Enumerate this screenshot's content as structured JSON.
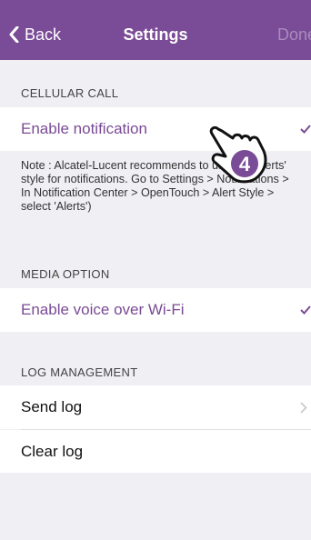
{
  "navbar": {
    "back_label": "Back",
    "title": "Settings",
    "done_label": "Done"
  },
  "sections": {
    "cellular": {
      "header": "CELLULAR CALL",
      "enable_notification": "Enable notification",
      "note": "Note : Alcatel-Lucent recommends to use the 'Alerts' style for notifications. Go to Settings > Notifications > In Notification Center > OpenTouch > Alert Style > select 'Alerts')"
    },
    "media": {
      "header": "MEDIA OPTION",
      "enable_voice_wifi": "Enable voice over Wi-Fi"
    },
    "log": {
      "header": "LOG MANAGEMENT",
      "send_log": "Send log",
      "clear_log": "Clear log"
    }
  },
  "overlay": {
    "step_number": "4"
  },
  "colors": {
    "accent": "#7a4b97",
    "background": "#efeff4"
  },
  "icons": [
    "chevron-left-icon",
    "checkmark-icon",
    "chevron-right-icon",
    "pointing-hand-icon"
  ]
}
